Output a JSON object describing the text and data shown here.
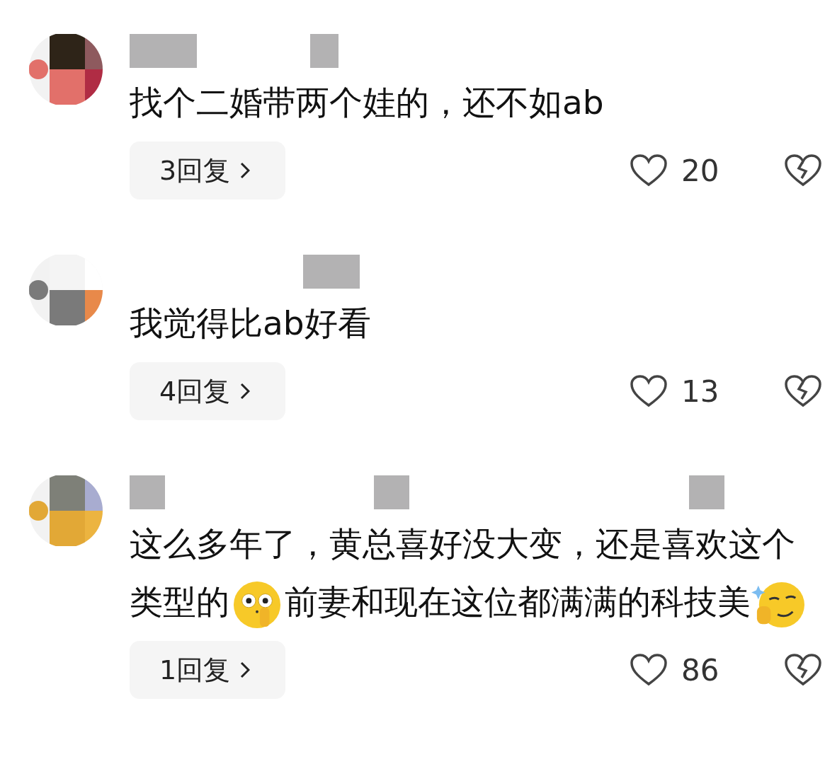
{
  "comments": [
    {
      "body": [
        {
          "kind": "text",
          "text": "找个二婚带两个娃的，还不如ab"
        }
      ],
      "replies": "3回复",
      "likes": "20"
    },
    {
      "body": [
        {
          "kind": "text",
          "text": "我觉得比ab好看"
        }
      ],
      "replies": "4回复",
      "likes": "13"
    },
    {
      "body": [
        {
          "kind": "text",
          "text": "这么多年了，黄总喜好没大变，还是喜欢这个类型的"
        },
        {
          "kind": "emoji"
        },
        {
          "kind": "text",
          "text": "前妻和现在这位都满满的科技美"
        },
        {
          "kind": "emoji"
        }
      ],
      "replies": "1回复",
      "likes": "86"
    }
  ]
}
